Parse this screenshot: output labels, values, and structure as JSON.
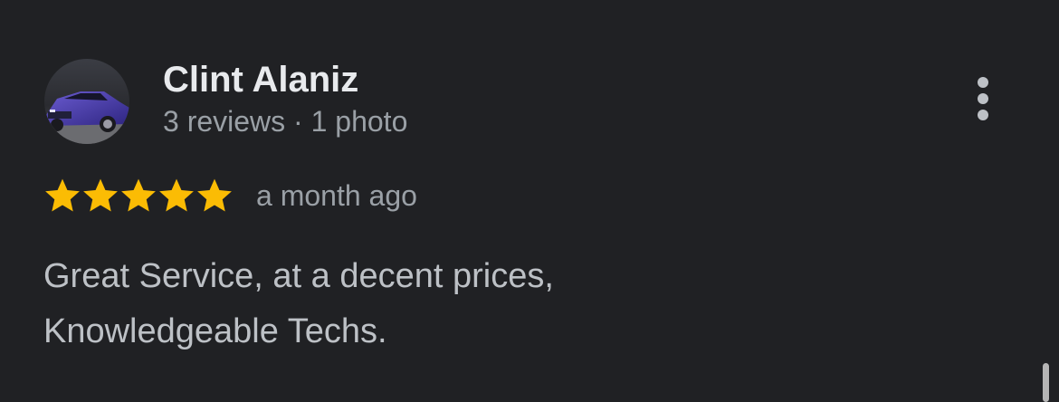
{
  "reviewer": {
    "name": "Clint Alaniz",
    "meta": "3 reviews · 1 photo",
    "avatar_icon": "avatar-car-photo"
  },
  "menu": {
    "icon": "more-vert-icon"
  },
  "rating": {
    "stars": 5,
    "max_stars": 5,
    "star_color": "#fbbc04",
    "date": "a month ago"
  },
  "review": {
    "lines": [
      "Great Service, at a decent prices,",
      "Knowledgeable Techs."
    ]
  },
  "colors": {
    "background": "#202124",
    "primary_text": "#e8eaed",
    "secondary_text": "#9aa0a6",
    "body_text": "#bdc1c6"
  }
}
